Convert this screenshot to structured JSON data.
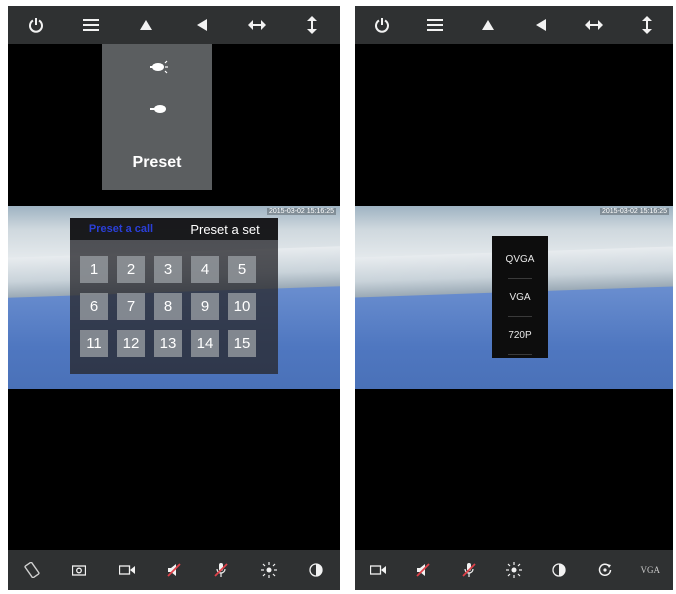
{
  "left": {
    "top_icons": [
      "power-icon",
      "menu-icon",
      "flip-up-icon",
      "flip-left-icon",
      "pan-horizontal-icon",
      "pan-vertical-icon"
    ],
    "dropdown": {
      "items": [
        "light-on-icon",
        "light-off-icon"
      ],
      "preset_label": "Preset"
    },
    "video_timestamp": "2015-03-02 15:16:25",
    "preset_panel": {
      "tab_call": "Preset a call",
      "tab_set": "Preset a set",
      "numbers": [
        "1",
        "2",
        "3",
        "4",
        "5",
        "6",
        "7",
        "8",
        "9",
        "10",
        "11",
        "12",
        "13",
        "14",
        "15"
      ]
    },
    "bottom_icons": [
      "rotate-icon",
      "camera-icon",
      "video-record-icon",
      "speaker-muted-icon",
      "mic-muted-icon",
      "brightness-icon",
      "contrast-icon"
    ]
  },
  "right": {
    "top_icons": [
      "power-icon",
      "menu-icon",
      "flip-up-icon",
      "flip-left-icon",
      "pan-horizontal-icon",
      "pan-vertical-icon"
    ],
    "video_timestamp": "2015-03-02 15:16:25",
    "resolution_options": [
      "QVGA",
      "VGA",
      "720P"
    ],
    "bottom_icons": [
      "video-record-icon",
      "speaker-muted-icon",
      "mic-muted-icon",
      "brightness-icon",
      "contrast-icon",
      "reset-icon",
      "resolution-button"
    ],
    "resolution_label": "VGA"
  },
  "colors": {
    "bar_bg": "#2f3132",
    "accent_tab": "#2a3fd8",
    "muted_red": "#e0424a"
  }
}
